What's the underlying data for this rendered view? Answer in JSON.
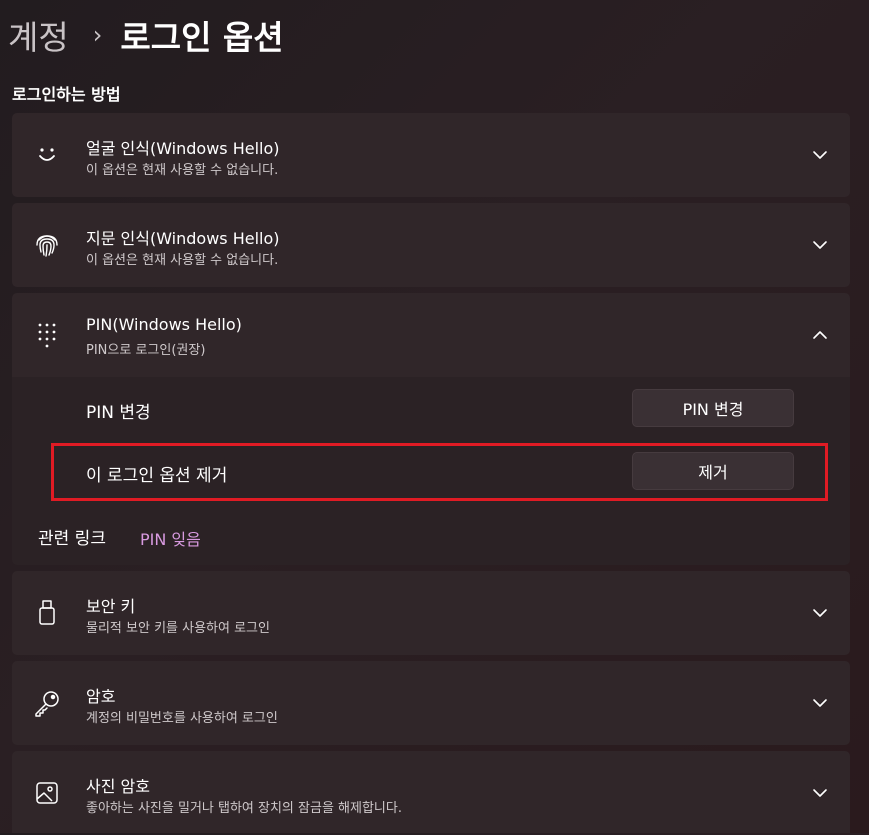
{
  "breadcrumb": {
    "parent": "계정",
    "separator": "›",
    "current": "로그인 옵션"
  },
  "section_title": "로그인하는 방법",
  "options": [
    {
      "icon": "face-smile-icon",
      "title": "얼굴 인식(Windows Hello)",
      "subtitle": "이 옵션은 현재 사용할 수 없습니다.",
      "expanded": false
    },
    {
      "icon": "fingerprint-icon",
      "title": "지문 인식(Windows Hello)",
      "subtitle": "이 옵션은 현재 사용할 수 없습니다.",
      "expanded": false
    },
    {
      "icon": "pin-keypad-icon",
      "title": "PIN(Windows Hello)",
      "subtitle": "PIN으로 로그인(권장)",
      "expanded": true
    },
    {
      "icon": "usb-key-icon",
      "title": "보안 키",
      "subtitle": "물리적 보안 키를 사용하여 로그인",
      "expanded": false
    },
    {
      "icon": "key-icon",
      "title": "암호",
      "subtitle": "계정의 비밀번호를 사용하여 로그인",
      "expanded": false
    },
    {
      "icon": "picture-icon",
      "title": "사진 암호",
      "subtitle": "좋아하는 사진을 밀거나 탭하여 장치의 잠금을 해제합니다.",
      "expanded": false
    }
  ],
  "pin_panel": {
    "change_label": "PIN 변경",
    "change_button": "PIN 변경",
    "remove_label": "이 로그인 옵션 제거",
    "remove_button": "제거",
    "related_label": "관련 링크",
    "related_link": "PIN 잊음"
  },
  "colors": {
    "highlight": "#e01b24",
    "link": "#d89ae0",
    "card": "#302629"
  }
}
